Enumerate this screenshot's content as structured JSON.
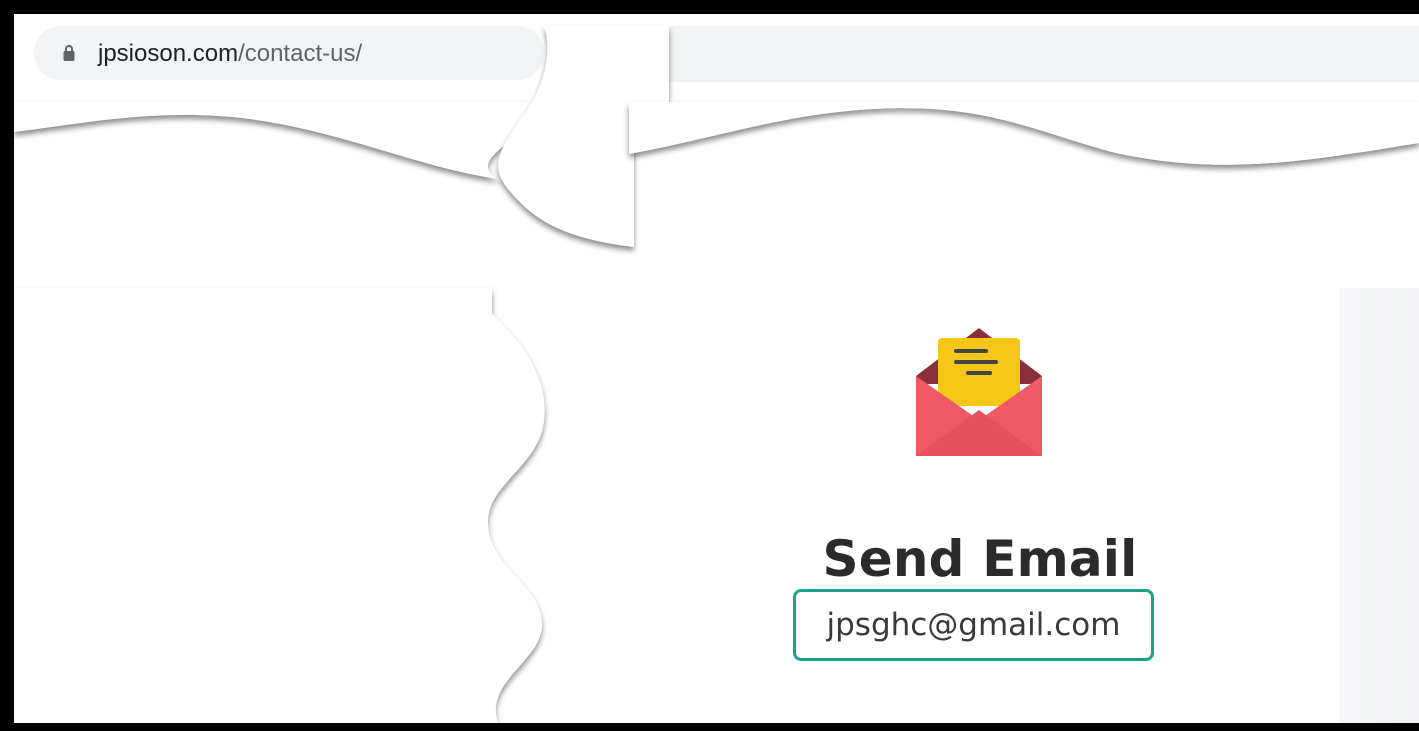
{
  "browser": {
    "url_host": "jpsioson.com",
    "url_path": "/contact-us/"
  },
  "icons": {
    "lock": "lock-icon",
    "mail": "open-envelope-icon"
  },
  "content": {
    "title": "Send Email",
    "email": "jpsghc@gmail.com"
  },
  "colors": {
    "chrome_bg": "#f1f3f4",
    "frame": "#000000",
    "title": "#2b2b2b",
    "email_border": "#1aa38c",
    "envelope_red": "#f05a67",
    "envelope_dark": "#8b2f3a",
    "letter_yellow": "#f3c617"
  }
}
